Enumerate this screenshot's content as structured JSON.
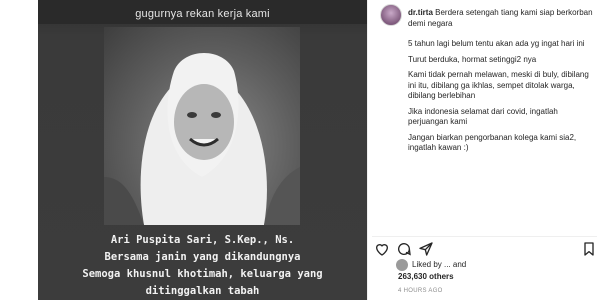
{
  "post": {
    "headline": "gugurnya rekan kerja kami",
    "caption_lines": [
      "Ari Puspita Sari, S.Kep., Ns.",
      "Bersama janin yang dikandungnya",
      "Semoga khusnul khotimah, keluarga yang",
      "ditinggalkan tabah"
    ]
  },
  "comment": {
    "username": "dr.tirta",
    "first_line": "Berdera setengah tiang kami siap berkorban demi negara",
    "paragraphs": [
      "5 tahun lagi belum tentu akan ada yg ingat hari ini",
      "Turut berduka, hormat setinggi2 nya",
      "Kami tidak pernah melawan, meski di buly, dibilang ini itu, dibilang ga ikhlas, sempet ditolak warga, dibilang berlebihan",
      "Jika indonesia selamat dari covid, ingatlah perjuangan kami",
      "Jangan biarkan pengorbanan kolega kami sia2, ingatlah kawan :)"
    ]
  },
  "actions": {
    "icons": [
      "heart-icon",
      "comment-icon",
      "share-icon",
      "bookmark-icon"
    ]
  },
  "liked_by": "Liked by ... and",
  "likes_count": "263,630 others",
  "timestamp": "4 HOURS AGO"
}
